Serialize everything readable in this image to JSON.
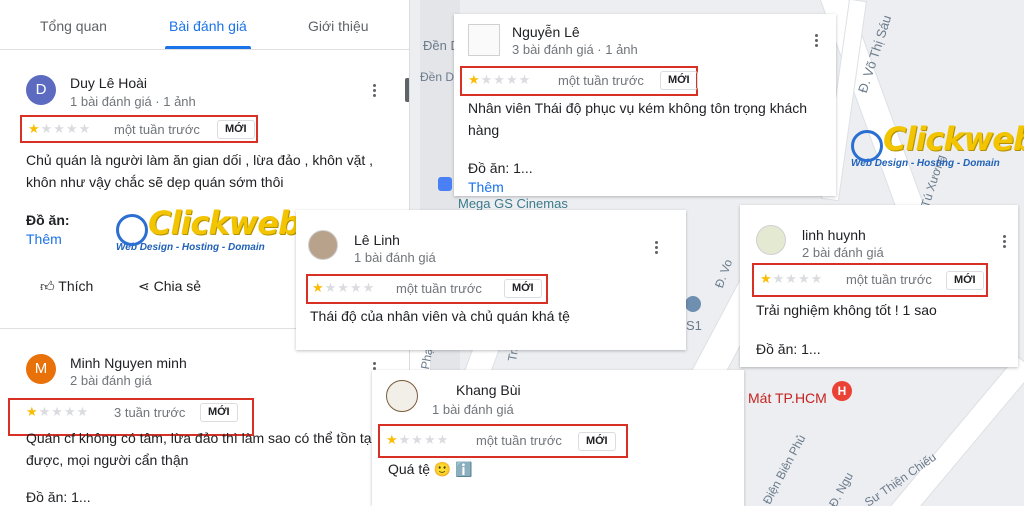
{
  "tabs": [
    {
      "label": "Tổng quan"
    },
    {
      "label": "Bài đánh giá"
    },
    {
      "label": "Giới thiệu"
    }
  ],
  "map": {
    "labels": [
      "Đ. Võ Thị Sáu",
      "Tú Xương",
      "Mega GS Cinemas",
      "Mát TP.HCM",
      "Điện Biên Phủ",
      "Sư Thiện Chiếu",
      "Đ. Ngu",
      "Đền Dứ",
      "Trần",
      "Đ. Vo",
      "S1",
      "Phạ",
      "Đ. Lê"
    ],
    "pin_letter": "H"
  },
  "logo": {
    "title": "Clickweb",
    "tagline": "Web Design - Hosting - Domain"
  },
  "actions": {
    "like": "Thích",
    "share": "Chia sẻ"
  },
  "star_colors": {
    "on": "#fbbc04",
    "off": "#dadce0"
  },
  "highlight_color": "#d93025",
  "reviews": [
    {
      "name": "Duy Lê Hoài",
      "avatar_letter": "D",
      "avatar_color": "#5c6bc0",
      "meta": "1 bài đánh giá · 1 ảnh",
      "stars": 1,
      "time": "một tuần trước",
      "badge": "MỚI",
      "text": "Chủ quán là người làm ăn gian dối , lừa đảo , khôn vặt , khôn như vậy chắc sẽ dẹp quán sớm thôi",
      "dish": "Đồ ăn:",
      "more": "Thêm"
    },
    {
      "name": "Minh Nguyen minh",
      "avatar_letter": "M",
      "avatar_color": "#e8710a",
      "meta": "2 bài đánh giá",
      "stars": 1,
      "time": "3 tuần trước",
      "badge": "MỚI",
      "text": "Quán cf không có tâm, lừa đảo thì làm sao có thể tồn tại được, mọi người cẩn thận",
      "dish": "Đồ ăn: 1..."
    },
    {
      "name": "Nguyễn Lê",
      "meta": "3 bài đánh giá · 1 ảnh",
      "stars": 1,
      "time": "một tuần trước",
      "badge": "MỚI",
      "text": "Nhân viên Thái độ phục vụ kém không tôn trọng khách hàng",
      "dish": "Đồ ăn: 1...",
      "more": "Thêm"
    },
    {
      "name": "Lê Linh",
      "meta": "1 bài đánh giá",
      "stars": 1,
      "time": "một tuần trước",
      "badge": "MỚI",
      "text": "Thái độ của nhân viên và chủ quán khá tệ"
    },
    {
      "name": "linh huynh",
      "meta": "2 bài đánh giá",
      "stars": 1,
      "time": "một tuần trước",
      "badge": "MỚI",
      "text": "Trải nghiệm không tốt ! 1 sao",
      "dish": "Đồ ăn: 1..."
    },
    {
      "name": "Khang Bùi",
      "meta": "1 bài đánh giá",
      "stars": 1,
      "time": "một tuần trước",
      "badge": "MỚI",
      "text": "Quá tệ 🙂 ℹ️"
    }
  ]
}
